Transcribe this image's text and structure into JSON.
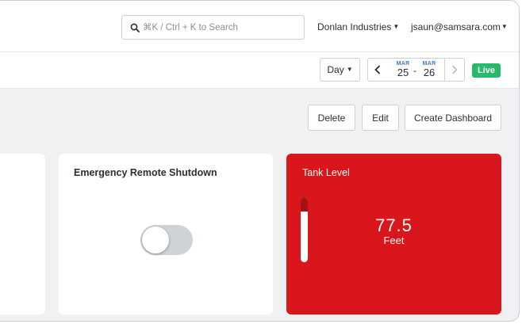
{
  "header": {
    "search": {
      "placeholder": "⌘K / Ctrl + K to Search",
      "icon": "search-icon"
    },
    "org_menu": {
      "label": "Donlan Industries"
    },
    "user_menu": {
      "label": "jsaun@samsara.com"
    }
  },
  "time_controls": {
    "range_select": {
      "label": "Day"
    },
    "start": {
      "month": "MAR",
      "day": "25"
    },
    "separator": "-",
    "end": {
      "month": "MAR",
      "day": "26"
    },
    "prev_icon": "chevron-left-icon",
    "next_icon": "chevron-right-icon",
    "live_badge": "Live"
  },
  "actions": {
    "delete": "Delete",
    "edit": "Edit",
    "create": "Create Dashboard"
  },
  "cards": {
    "shutdown": {
      "title": "Emergency Remote Shutdown",
      "toggle_on": false
    },
    "tank": {
      "title": "Tank Level",
      "value": "77.5",
      "unit": "Feet",
      "gauge_fraction": 0.78
    }
  },
  "colors": {
    "tank_card": "#d8161b",
    "live_badge": "#27ba6a",
    "date_month": "#3a78d8",
    "toggle_off": "#cfd2d6"
  }
}
